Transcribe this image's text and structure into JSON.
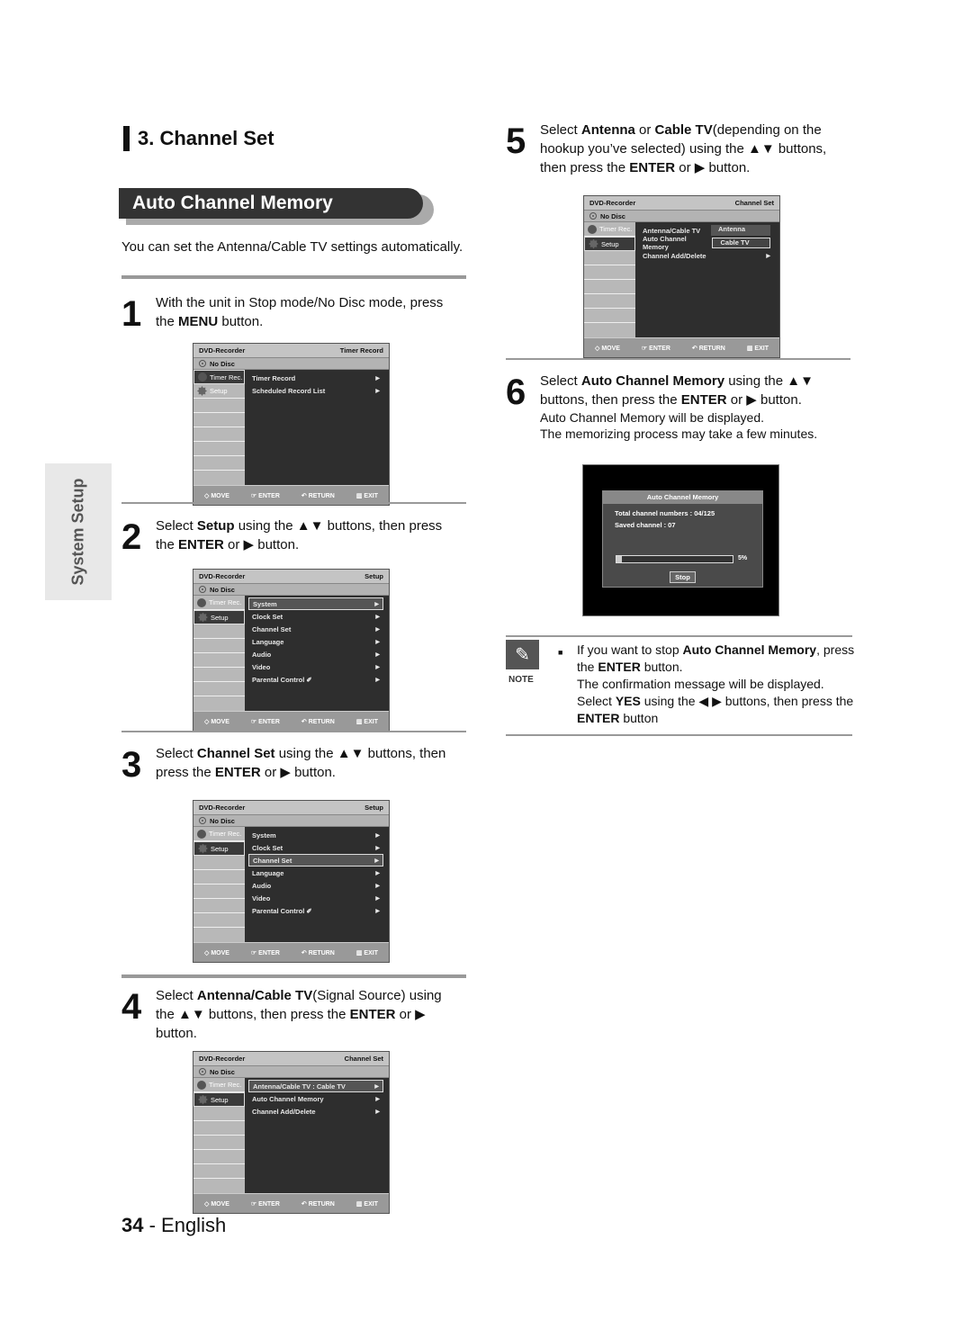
{
  "section": {
    "title": "3. Channel Set"
  },
  "banner": {
    "title": "Auto Channel Memory"
  },
  "intro": "You can set the Antenna/Cable TV settings automatically.",
  "side_tab": "System Setup",
  "steps": [
    {
      "num": "1",
      "parts": [
        "With the unit in Stop mode/No Disc mode, press the ",
        "MENU",
        " button."
      ]
    },
    {
      "num": "2",
      "parts": [
        "Select ",
        "Setup",
        " using the ▲▼ buttons, then press the ",
        "ENTER",
        " or ▶ button."
      ]
    },
    {
      "num": "3",
      "parts": [
        "Select ",
        "Channel Set",
        " using the ▲▼ buttons, then press the ",
        "ENTER",
        " or ▶ button."
      ]
    },
    {
      "num": "4",
      "parts": [
        "Select ",
        "Antenna/Cable TV",
        "(Signal Source) using the ▲▼ buttons, then press the ",
        "ENTER",
        " or ▶ button."
      ]
    },
    {
      "num": "5",
      "parts": [
        "Select ",
        "Antenna",
        " or ",
        "Cable TV",
        "(depending on the hookup you’ve selected) using the ▲▼ buttons, then press the ",
        "ENTER",
        " or ▶ button."
      ]
    },
    {
      "num": "6",
      "parts": [
        "Select ",
        "Auto Channel Memory",
        " using the ▲▼ buttons, then press the ",
        "ENTER",
        " or ▶ button."
      ],
      "sub": [
        "Auto Channel Memory will be displayed.",
        "The memorizing process may take a few minutes."
      ]
    }
  ],
  "osd_common": {
    "brand": "DVD-Recorder",
    "disc": "No Disc",
    "side": [
      "Timer Rec.",
      "Setup"
    ],
    "footer": [
      "MOVE",
      "ENTER",
      "RETURN",
      "EXIT"
    ],
    "arrow": "▶"
  },
  "screens": [
    {
      "title": "Timer Record",
      "side_selected": 0,
      "items": [
        "Timer Record",
        "Scheduled Record List"
      ],
      "highlight": -1
    },
    {
      "title": "Setup",
      "side_selected": 1,
      "items": [
        "System",
        "Clock Set",
        "Channel Set",
        "Language",
        "Audio",
        "Video",
        "Parental Control ✐"
      ],
      "highlight": 0
    },
    {
      "title": "Setup",
      "side_selected": 1,
      "items": [
        "System",
        "Clock Set",
        "Channel Set",
        "Language",
        "Audio",
        "Video",
        "Parental Control ✐"
      ],
      "highlight": 2
    },
    {
      "title": "Channel Set",
      "side_selected": 1,
      "items": [
        "Antenna/Cable TV : Cable TV",
        "Auto Channel Memory",
        "Channel Add/Delete"
      ],
      "highlight": 0
    },
    {
      "title": "Channel Set",
      "side_selected": 1,
      "items": [
        "Antenna/Cable TV",
        "Auto Channel Memory",
        "Channel Add/Delete"
      ],
      "highlight": -1,
      "popup": [
        "Antenna",
        "Cable TV"
      ],
      "popup_selected": 1
    }
  ],
  "acm_screen": {
    "title": "Auto Channel Memory",
    "total_label": "Total channel numbers :  04/125",
    "saved_label": "Saved channel : 07",
    "progress_percent": 5,
    "progress_label": "5%",
    "stop_label": "Stop"
  },
  "note": {
    "label": "NOTE",
    "parts": [
      "If you want to stop ",
      "Auto Channel Memory",
      ", press the ",
      "ENTER",
      " button.",
      "The confirmation message will be displayed.",
      "Select ",
      "YES",
      " using the ◀ ▶  buttons, then press the ",
      "ENTER",
      " button"
    ]
  },
  "footer": {
    "page": "34",
    "lang": " - English"
  }
}
